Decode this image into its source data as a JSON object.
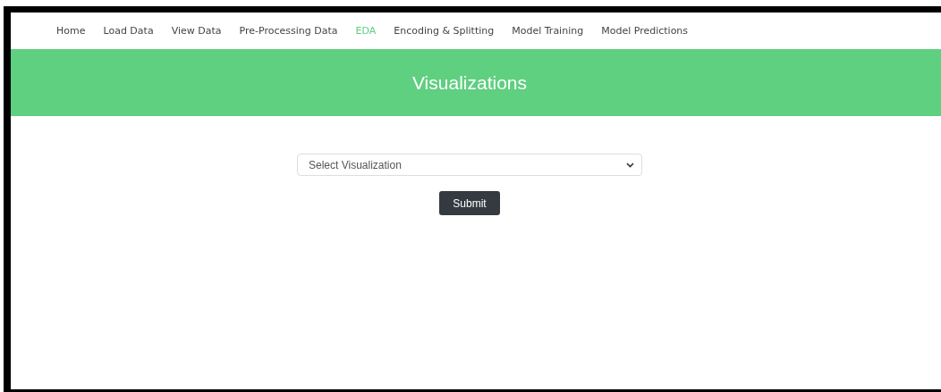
{
  "nav": [
    {
      "label": "Home",
      "selected": false
    },
    {
      "label": "Load Data",
      "selected": false
    },
    {
      "label": "View Data",
      "selected": false
    },
    {
      "label": "Pre-Processing Data",
      "selected": false
    },
    {
      "label": "EDA",
      "selected": true
    },
    {
      "label": "Encoding & Splitting",
      "selected": false
    },
    {
      "label": "Model Training",
      "selected": false
    },
    {
      "label": "Model Predictions",
      "selected": false
    }
  ],
  "banner": {
    "title": "Visualizations"
  },
  "form": {
    "select": {
      "placeholder": "Select Visualization"
    },
    "submit": "Submit"
  }
}
